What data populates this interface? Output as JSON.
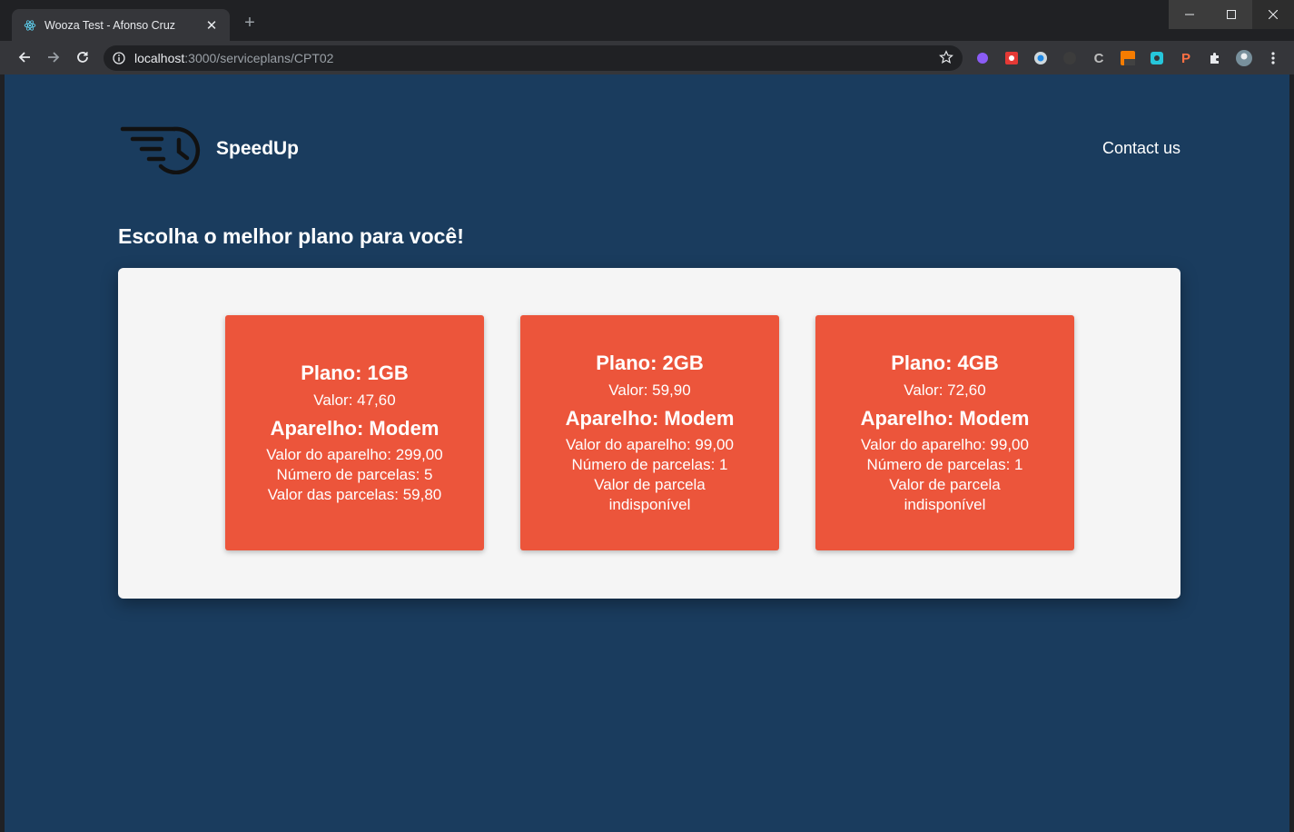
{
  "browser": {
    "tab_title": "Wooza Test - Afonso Cruz",
    "url_host": "localhost",
    "url_path": ":3000/serviceplans/CPT02"
  },
  "site": {
    "brand": "SpeedUp",
    "contact": "Contact us",
    "headline": "Escolha o melhor plano para você!"
  },
  "plans": [
    {
      "title": "Plano: 1GB",
      "price": "Valor: 47,60",
      "device": "Aparelho: Modem",
      "lines": [
        "Valor do aparelho: 299,00",
        "Número de parcelas: 5",
        "Valor das parcelas: 59,80"
      ]
    },
    {
      "title": "Plano: 2GB",
      "price": "Valor: 59,90",
      "device": "Aparelho: Modem",
      "lines": [
        "Valor do aparelho: 99,00",
        "Número de parcelas: 1",
        "Valor de parcela",
        "indisponível"
      ]
    },
    {
      "title": "Plano: 4GB",
      "price": "Valor: 72,60",
      "device": "Aparelho: Modem",
      "lines": [
        "Valor do aparelho: 99,00",
        "Número de parcelas: 1",
        "Valor de parcela",
        "indisponível"
      ]
    }
  ],
  "colors": {
    "page_background": "#1a3c5e",
    "panel_background": "#f5f5f5",
    "card_accent": "#ec553b"
  },
  "icons": {
    "tab_favicon": "react-atom-icon",
    "logo": "speed-clock-icon"
  }
}
